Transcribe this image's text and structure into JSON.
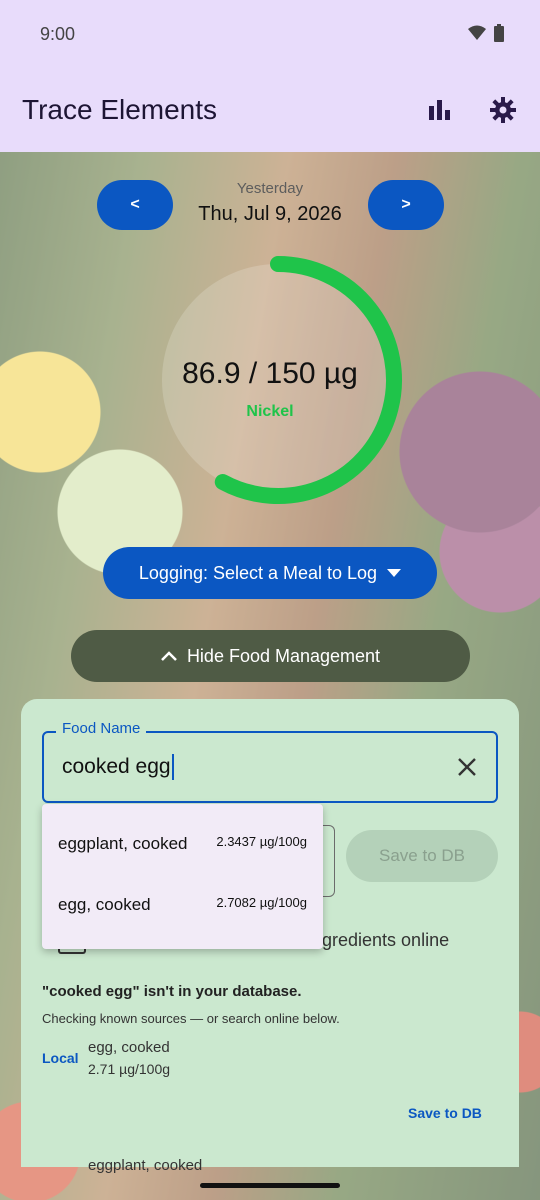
{
  "status": {
    "time": "9:00"
  },
  "app": {
    "title": "Trace Elements"
  },
  "date": {
    "prev_label": "<",
    "next_label": ">",
    "relative": "Yesterday",
    "full": "Thu, Jul 9, 2026"
  },
  "progress": {
    "value_text": "86.9 / 150 µg",
    "element": "Nickel",
    "fraction": 0.579,
    "color": "#1fc44a"
  },
  "buttons": {
    "logging": "Logging: Select a Meal to Log",
    "hide_food": "Hide Food Management",
    "save_db": "Save to DB"
  },
  "food_field": {
    "label": "Food Name",
    "value": "cooked egg"
  },
  "suggestions": [
    {
      "name": "eggplant, cooked",
      "value": "2.3437 µg/100g"
    },
    {
      "name": "egg, cooked",
      "value": "2.7082 µg/100g"
    }
  ],
  "online_search": {
    "text": "gredients online"
  },
  "result": {
    "not_found": "\"cooked egg\" isn't in your database.",
    "checking": "Checking known sources — or search online below.",
    "source_label": "Local",
    "source_name": "egg, cooked",
    "source_value": "2.71 µg/100g",
    "save_link": "Save to DB",
    "next_name": "eggplant, cooked"
  },
  "colors": {
    "accent": "#0b57c2",
    "app_bar": "#e8dcfb",
    "panel": "#cbe8cf",
    "collapse_button": "#4f5b45"
  }
}
